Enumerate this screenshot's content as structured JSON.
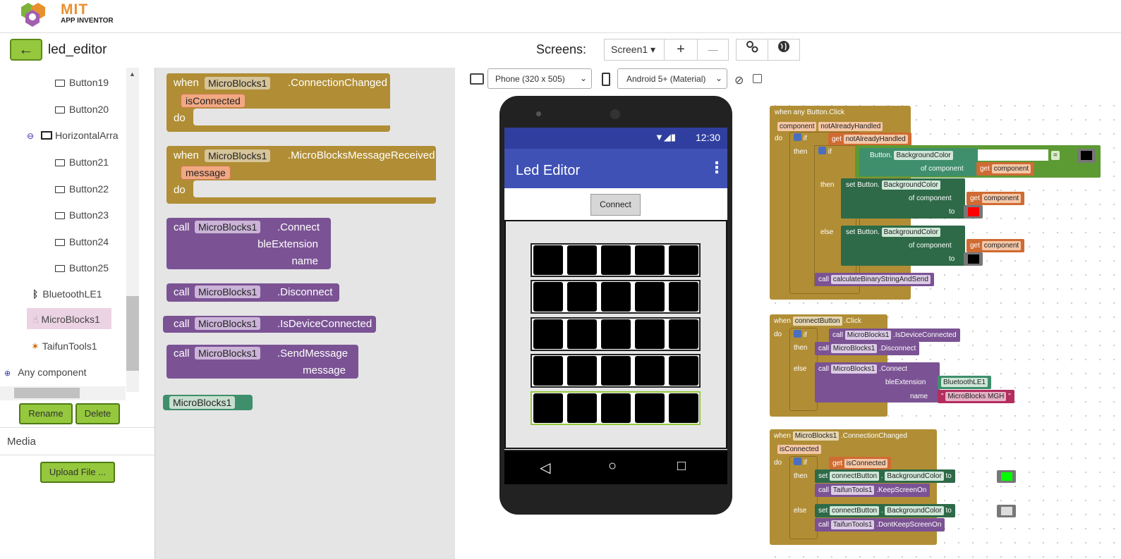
{
  "header": {
    "logo_title": "MIT",
    "logo_subtitle": "APP INVENTOR"
  },
  "project": {
    "back_label": "←",
    "name": "led_editor",
    "screens_label": "Screens:",
    "screen_selected": "Screen1 ▾",
    "add_screen": "+",
    "remove_screen": "—"
  },
  "tree": {
    "items": [
      "Button19",
      "Button20",
      "HorizontalArra",
      "Button21",
      "Button22",
      "Button23",
      "Button24",
      "Button25",
      "BluetoothLE1",
      "MicroBlocks1",
      "TaifunTools1",
      "Any component"
    ],
    "collapse": "⊖",
    "expand": "⊕"
  },
  "buttons": {
    "rename": "Rename",
    "delete": "Delete",
    "media": "Media",
    "upload": "Upload File ..."
  },
  "drawer": {
    "b1": {
      "when": "when",
      "comp": "MicroBlocks1",
      "evt": ".ConnectionChanged",
      "param": "isConnected",
      "do": "do"
    },
    "b2": {
      "when": "when",
      "comp": "MicroBlocks1",
      "evt": ".MicroBlocksMessageReceived",
      "param": "message",
      "do": "do"
    },
    "b3": {
      "call": "call",
      "comp": "MicroBlocks1",
      "method": ".Connect",
      "arg1": "bleExtension",
      "arg2": "name"
    },
    "b4": {
      "call": "call",
      "comp": "MicroBlocks1",
      "method": ".Disconnect"
    },
    "b5": {
      "call": "call",
      "comp": "MicroBlocks1",
      "method": ".IsDeviceConnected"
    },
    "b6": {
      "call": "call",
      "comp": "MicroBlocks1",
      "method": ".SendMessage",
      "arg1": "message"
    },
    "b7": {
      "comp": "MicroBlocks1"
    }
  },
  "viewer": {
    "device": "Phone (320 x 505)",
    "theme": "Android 5+ (Material)",
    "time": "12:30",
    "app_title": "Led Editor",
    "menu": "⋮",
    "connect": "Connect",
    "nav_back": "◁",
    "nav_home": "○",
    "nav_recent": "□"
  },
  "ws": {
    "w1": {
      "title": "when any Button.Click",
      "p1": "component",
      "p2": "notAlreadyHandled",
      "do": "do",
      "if": "if",
      "get": "get",
      "getv": "notAlreadyHandled",
      "then": "then",
      "if2": "if",
      "btn": "Button.",
      "prop": "BackgroundColor",
      "ofc": "of component",
      "get2": "get",
      "comp": "component",
      "eq": "=",
      "then2": "then",
      "set1": "set Button.",
      "prop1": "BackgroundColor",
      "ofc1": "of component",
      "get3": "get",
      "comp1": "component",
      "to1": "to",
      "else": "else",
      "set2": "set Button.",
      "prop2": "BackgroundColor",
      "ofc2": "of component",
      "get4": "get",
      "comp2": "component",
      "to2": "to",
      "call": "call",
      "proc": "calculateBinaryStringAndSend"
    },
    "w2": {
      "when": "when",
      "comp": "connectButton",
      "evt": ".Click",
      "do": "do",
      "if": "if",
      "call1": "call",
      "c1": "MicroBlocks1",
      "m1": ".IsDeviceConnected",
      "then": "then",
      "call2": "call",
      "c2": "MicroBlocks1",
      "m2": ".Disconnect",
      "else": "else",
      "call3": "call",
      "c3": "MicroBlocks1",
      "m3": ".Connect",
      "a1": "bleExtension",
      "v1": "BluetoothLE1",
      "a2": "name",
      "v2": "MicroBlocks MGH"
    },
    "w3": {
      "when": "when",
      "comp": "MicroBlocks1",
      "evt": ".ConnectionChanged",
      "param": "isConnected",
      "do": "do",
      "if": "if",
      "get": "get",
      "getv": "isConnected",
      "then": "then",
      "set1": "set",
      "c1": "connectButton",
      "p1": "BackgroundColor",
      "to1": "to",
      "call1": "call",
      "t1": "TaifunTools1",
      "m1": ".KeepScreenOn",
      "else": "else",
      "set2": "set",
      "c2": "connectButton",
      "p2": "BackgroundColor",
      "to2": "to",
      "call2": "call",
      "t2": "TaifunTools1",
      "m2": ".DontKeepScreenOn"
    }
  },
  "colors": {
    "accent": "#95c83d",
    "event": "#b18e35",
    "procedure": "#7b5394",
    "component": "#3f8f6c",
    "appbar": "#3f51b5"
  }
}
